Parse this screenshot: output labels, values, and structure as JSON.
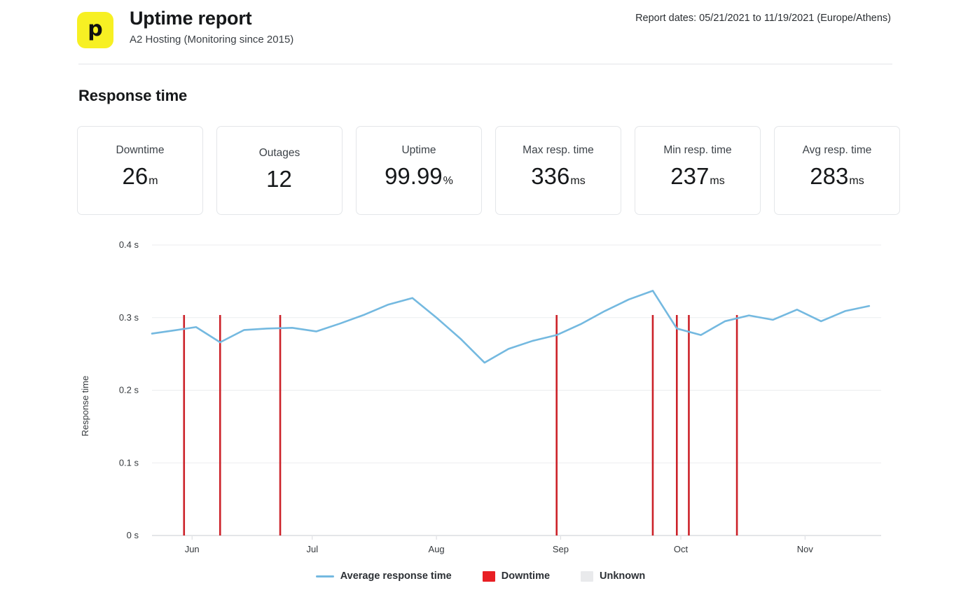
{
  "header": {
    "logo_icon": "pingdom-logo-icon",
    "logo_glyph": "p",
    "logo_color": "#f7f023",
    "title": "Uptime report",
    "subtitle": "A2 Hosting (Monitoring since 2015)",
    "report_dates": "Report dates: 05/21/2021 to 11/19/2021 (Europe/Athens)"
  },
  "section": {
    "title": "Response time"
  },
  "cards": [
    {
      "label": "Downtime",
      "value": "26",
      "unit": "m"
    },
    {
      "label": "Outages",
      "value": "12",
      "unit": ""
    },
    {
      "label": "Uptime",
      "value": "99.99",
      "unit": "%"
    },
    {
      "label": "Max resp. time",
      "value": "336",
      "unit": "ms"
    },
    {
      "label": "Min resp. time",
      "value": "237",
      "unit": "ms"
    },
    {
      "label": "Avg resp. time",
      "value": "283",
      "unit": "ms"
    }
  ],
  "legend": [
    {
      "name": "average-response-time",
      "label": "Average response time",
      "type": "line",
      "color": "#74b9e0"
    },
    {
      "name": "downtime",
      "label": "Downtime",
      "type": "box",
      "color": "#e81f24"
    },
    {
      "name": "unknown",
      "label": "Unknown",
      "type": "box",
      "color": "#e9eaec"
    }
  ],
  "chart_data": {
    "type": "line",
    "title": "Response time",
    "xlabel": "",
    "ylabel": "Response time",
    "ylim": [
      0,
      0.4
    ],
    "ytick_values": [
      0,
      0.1,
      0.2,
      0.3,
      0.4
    ],
    "ytick_labels": [
      "0 s",
      "0.1 s",
      "0.2 s",
      "0.3 s",
      "0.4 s"
    ],
    "xtick_labels": [
      "Jun",
      "Jul",
      "Aug",
      "Sep",
      "Oct",
      "Nov"
    ],
    "xtick_positions_days": [
      10,
      40,
      71,
      102,
      132,
      163
    ],
    "x_range_days": [
      0,
      182
    ],
    "grid": "horizontal",
    "legend_position": "bottom-center",
    "series": [
      {
        "name": "Average response time",
        "color": "#74b9e0",
        "unit": "s",
        "x_days": [
          0,
          5,
          11,
          17,
          23,
          29,
          35,
          41,
          47,
          53,
          59,
          65,
          71,
          77,
          83,
          89,
          95,
          101,
          107,
          113,
          119,
          125,
          131,
          137,
          143,
          149,
          155,
          161,
          167,
          173,
          179
        ],
        "values": [
          0.278,
          0.282,
          0.287,
          0.266,
          0.283,
          0.285,
          0.286,
          0.281,
          0.292,
          0.304,
          0.318,
          0.327,
          0.3,
          0.271,
          0.238,
          0.257,
          0.268,
          0.276,
          0.291,
          0.309,
          0.325,
          0.337,
          0.285,
          0.276,
          0.295,
          0.303,
          0.297,
          0.311,
          0.295,
          0.309,
          0.316
        ]
      }
    ],
    "downtime_events": {
      "name": "Downtime",
      "color": "#cc2229",
      "x_days": [
        8,
        17,
        32,
        101,
        125,
        131,
        134,
        146
      ]
    }
  }
}
